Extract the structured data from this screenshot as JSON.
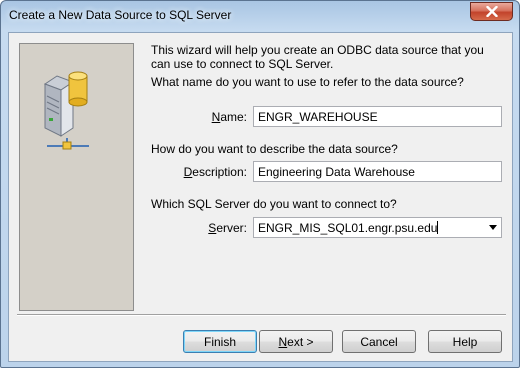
{
  "window": {
    "title": "Create a New Data Source to SQL Server"
  },
  "icons": {
    "close": "close-icon",
    "illustration": "database-server-icon",
    "dropdown": "chevron-down-icon"
  },
  "intro": "This wizard will help you create an ODBC data source that you can use to connect to SQL Server.",
  "name_section": {
    "question": "What name do you want to use to refer to the data source?",
    "label_accel": "N",
    "label_rest": "ame:",
    "value": "ENGR_WAREHOUSE"
  },
  "description_section": {
    "question": "How do you want to describe the data source?",
    "label_accel": "D",
    "label_rest": "escription:",
    "value": "Engineering Data Warehouse"
  },
  "server_section": {
    "question": "Which SQL Server do you want to connect to?",
    "label_accel": "S",
    "label_rest": "erver:",
    "value": "ENGR_MIS_SQL01.engr.psu.edu"
  },
  "buttons": {
    "finish": "Finish",
    "next_accel": "N",
    "next_rest": "ext >",
    "cancel": "Cancel",
    "help": "Help"
  }
}
